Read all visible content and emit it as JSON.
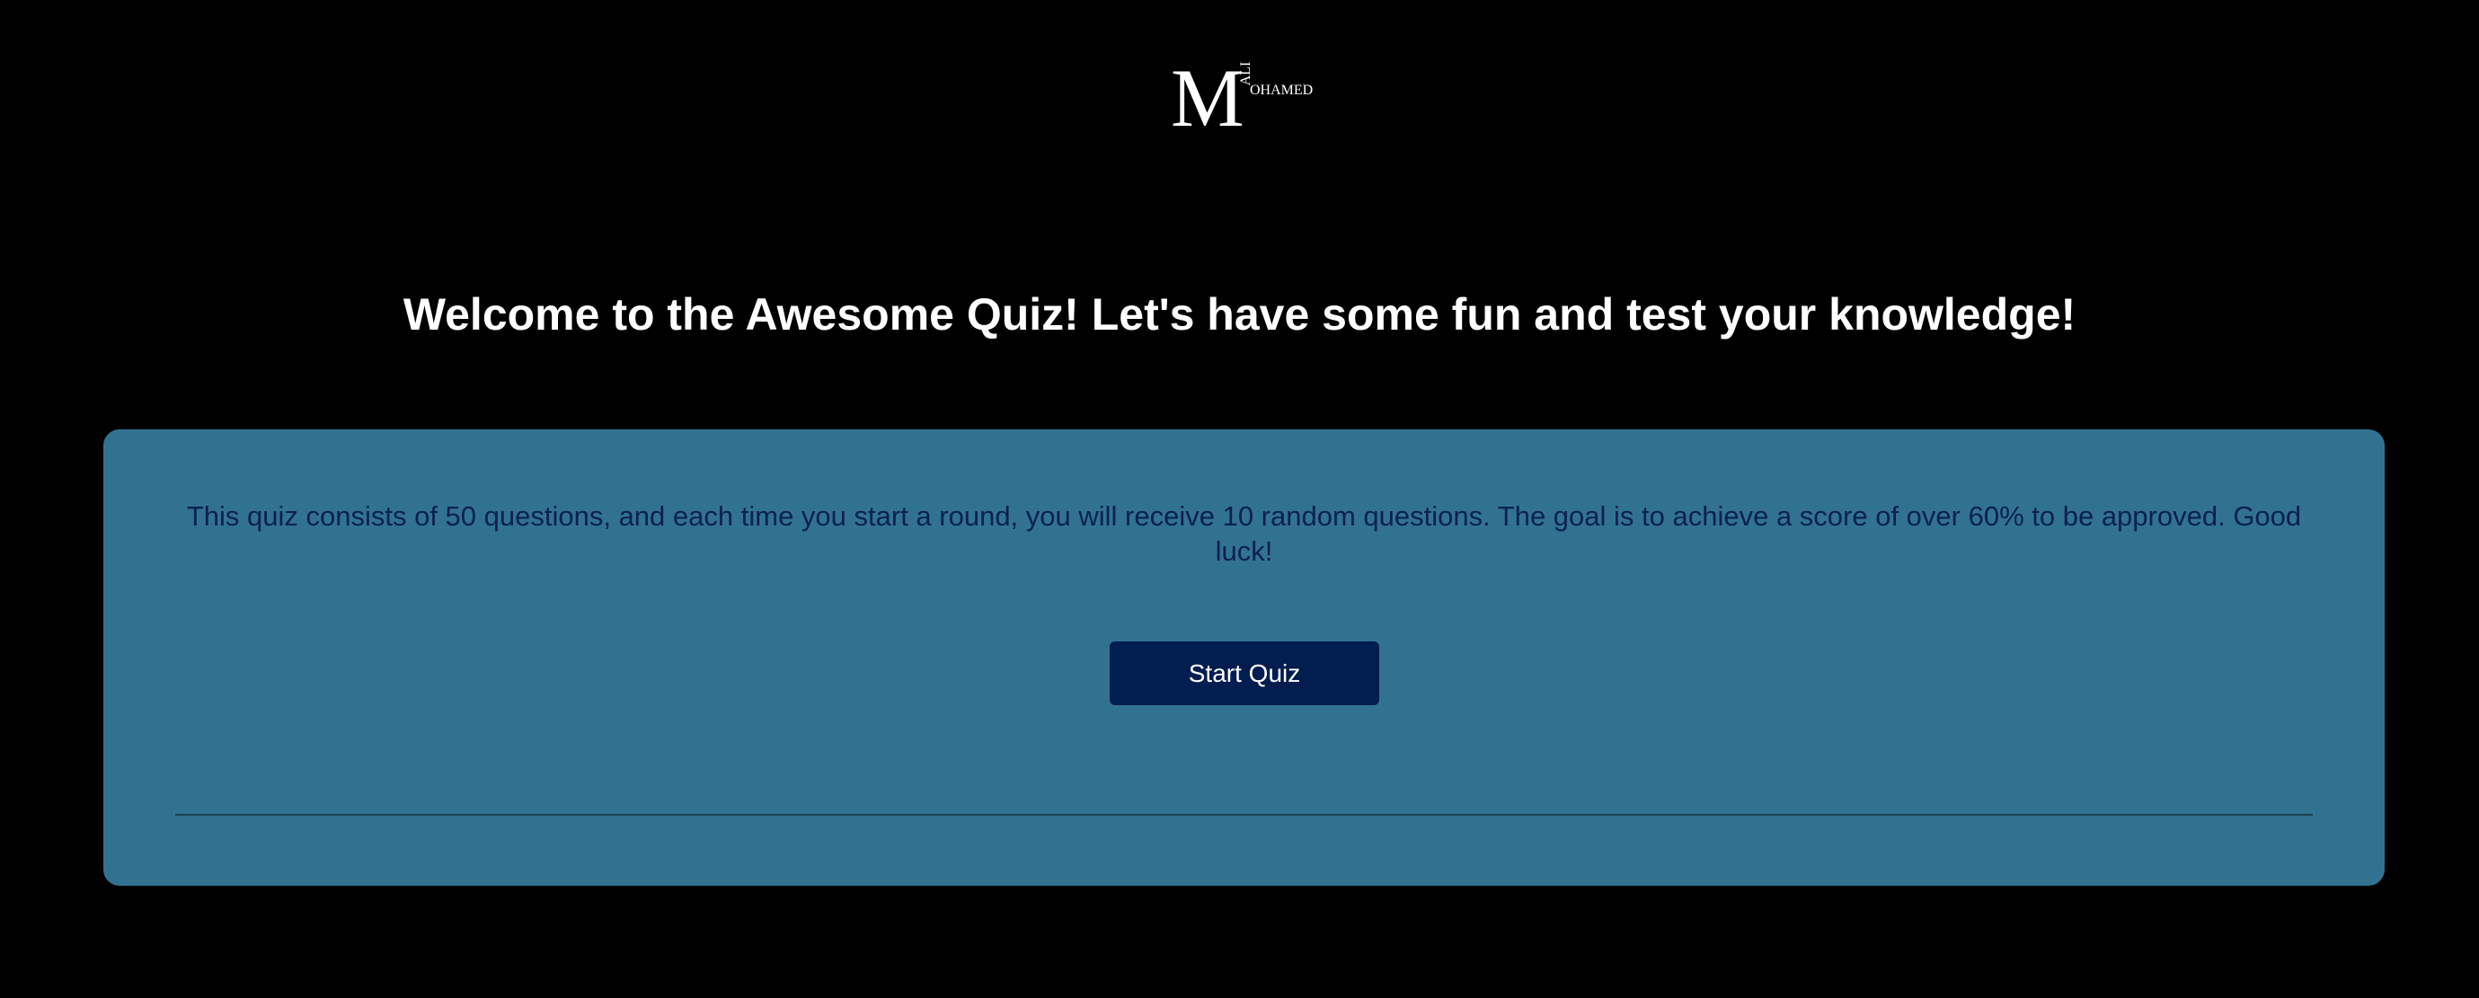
{
  "logo": {
    "icon": "mohamed-ali-monogram-logo",
    "initial": "M",
    "small_vertical": "ALI",
    "small_horizontal": "OHAMED"
  },
  "header": {
    "welcome_text": "Welcome to the Awesome Quiz! Let's have some fun and test your knowledge!"
  },
  "card": {
    "intro_text": "This quiz consists of 50 questions, and each time you start a round, you will receive 10 random questions. The goal is to achieve a score of over 60% to be approved. Good luck!",
    "start_button_label": "Start Quiz"
  },
  "colors": {
    "background": "#000000",
    "card": "#327291",
    "intro_text": "#0a2150",
    "button": "#021d4f",
    "button_text": "#ffffff",
    "heading": "#ffffff"
  }
}
